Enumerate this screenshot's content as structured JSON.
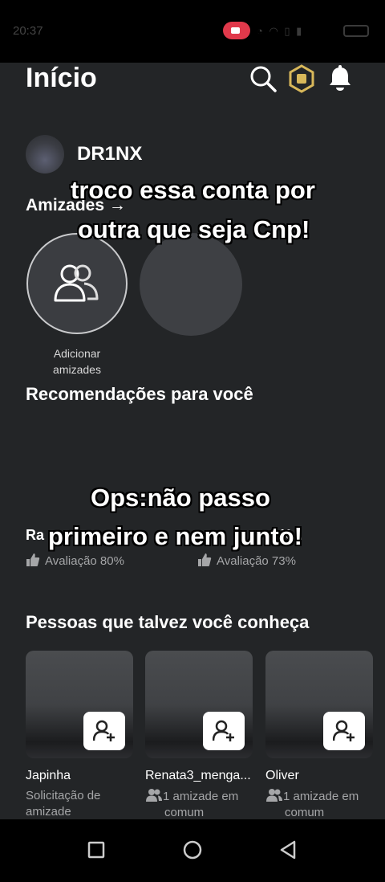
{
  "status_bar": {
    "time": "20:37"
  },
  "header": {
    "title": "Início",
    "icons": [
      "search-icon",
      "robux-icon",
      "bell-icon"
    ]
  },
  "profile": {
    "username": "DR1NX"
  },
  "friends": {
    "heading": "Amizades →",
    "add_label_line1": "Adicionar",
    "add_label_line2": "amizades"
  },
  "recommendations": {
    "heading": "Recomendações para você",
    "items": [
      {
        "title": "Ra",
        "rating": "Avaliação 80%"
      },
      {
        "title": "X...",
        "rating": "Avaliação 73%"
      }
    ]
  },
  "people": {
    "heading": "Pessoas que talvez você conheça",
    "items": [
      {
        "name": "Japinha",
        "sub_line1": "Solicitação de",
        "sub_line2": "amizade",
        "mutual": false
      },
      {
        "name": "Renata3_menga...",
        "sub_line1": "1 amizade em",
        "sub_line2": "comum",
        "mutual": true
      },
      {
        "name": "Oliver",
        "sub_line1": "1 amizade em",
        "sub_line2": "comum",
        "mutual": true
      }
    ]
  },
  "overlay_captions": {
    "first_line1": "troco essa conta por",
    "first_line2": "outra que seja Cnp!",
    "second_line1": "Ops:não passo",
    "second_line2": "primeiro e nem junto!"
  },
  "navbar": {
    "buttons": [
      "recent-apps",
      "home",
      "back"
    ]
  },
  "colors": {
    "background": "#232527",
    "text": "#ffffff",
    "muted": "#a5a6a8",
    "robux_gold": "#d8b85a",
    "record": "#e0394b"
  }
}
